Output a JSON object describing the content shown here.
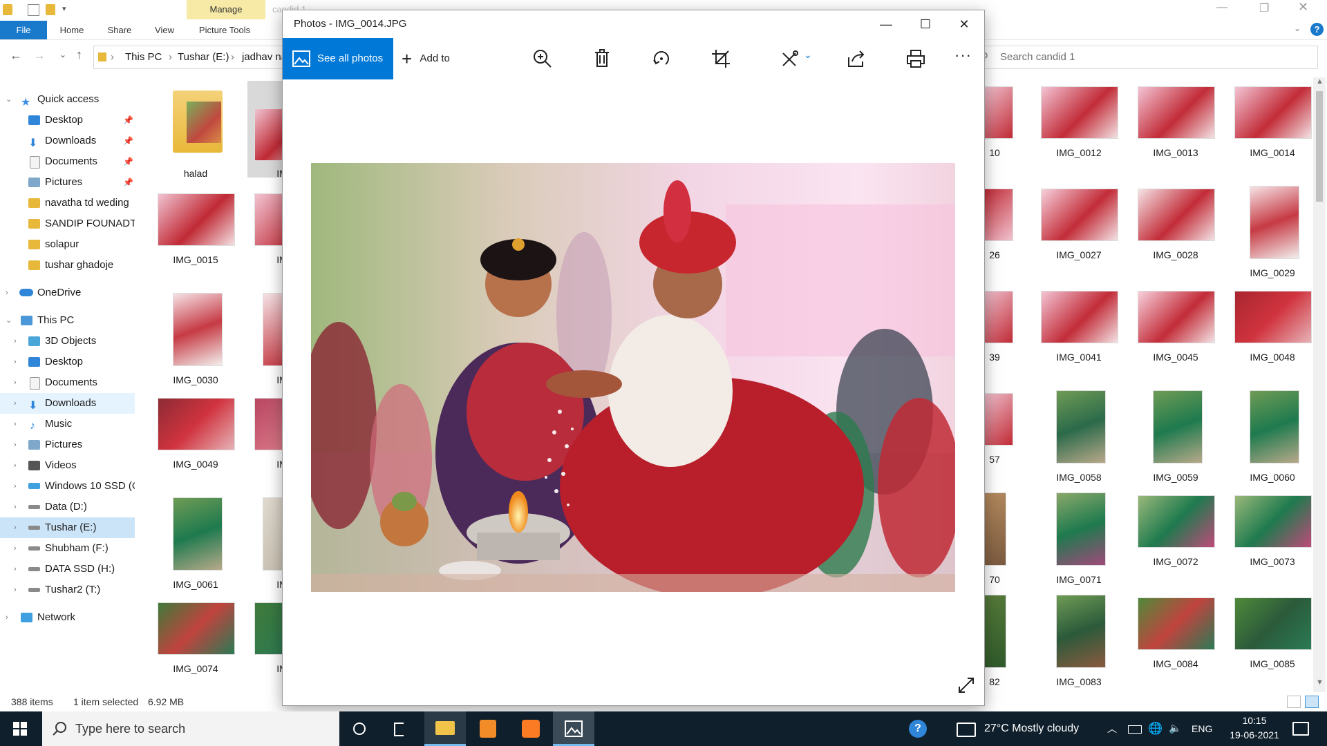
{
  "explorer": {
    "ribbon": {
      "manage": "Manage",
      "tabs": [
        "File",
        "Home",
        "Share",
        "View",
        "Picture Tools"
      ],
      "ghost_title": "candid 1"
    },
    "address": {
      "segments": [
        "This PC",
        "Tushar (E:)",
        "jadhav na"
      ],
      "separator": "›"
    },
    "search_placeholder": "Search candid 1",
    "nav": {
      "quick_access": "Quick access",
      "quick_items": [
        "Desktop",
        "Downloads",
        "Documents",
        "Pictures",
        "navatha td weding",
        "SANDIP FOUNADTI",
        "solapur",
        "tushar ghadoje"
      ],
      "onedrive": "OneDrive",
      "this_pc": "This PC",
      "pc_items": [
        "3D Objects",
        "Desktop",
        "Documents",
        "Downloads",
        "Music",
        "Pictures",
        "Videos",
        "Windows 10 SSD (C",
        "Data (D:)",
        "Tushar (E:)",
        "Shubham (F:)",
        "DATA SSD (H:)",
        "Tushar2 (T:)"
      ],
      "network": "Network"
    },
    "left_captions": [
      "halad",
      "IMG_0015",
      "IMG_0030",
      "IMG_0049",
      "IMG_0061",
      "IMG_0074"
    ],
    "second_col_captions": [
      "IM",
      "IM",
      "IM",
      "IM",
      "IM",
      "IM"
    ],
    "partial_right_captions": [
      "10",
      "26",
      "39",
      "57",
      "70",
      "82"
    ],
    "right_rows": [
      [
        "IMG_0012",
        "IMG_0013",
        "IMG_0014"
      ],
      [
        "IMG_0027",
        "IMG_0028",
        "IMG_0029"
      ],
      [
        "IMG_0041",
        "IMG_0045",
        "IMG_0048"
      ],
      [
        "IMG_0058",
        "IMG_0059",
        "IMG_0060"
      ],
      [
        "IMG_0071",
        "IMG_0072",
        "IMG_0073"
      ],
      [
        "IMG_0083",
        "IMG_0084",
        "IMG_0085"
      ]
    ],
    "status": {
      "count": "388 items",
      "selected": "1 item selected",
      "size": "6.92 MB"
    }
  },
  "photos": {
    "title": "Photos - IMG_0014.JPG",
    "see_all": "See all photos",
    "add_to": "Add to",
    "controls": {
      "minimize": "—",
      "maximize": "☐",
      "close": "✕"
    }
  },
  "taskbar": {
    "search_placeholder": "Type here to search",
    "weather": "27°C  Mostly cloudy",
    "lang": "ENG",
    "time": "10:15",
    "date": "19-06-2021"
  },
  "colors": {
    "accent": "#0078d7",
    "file_tab": "#1979ca",
    "manage": "#f7eaa6",
    "taskbar": "#0f1f2b",
    "nav_selected": "#cce4f7"
  }
}
